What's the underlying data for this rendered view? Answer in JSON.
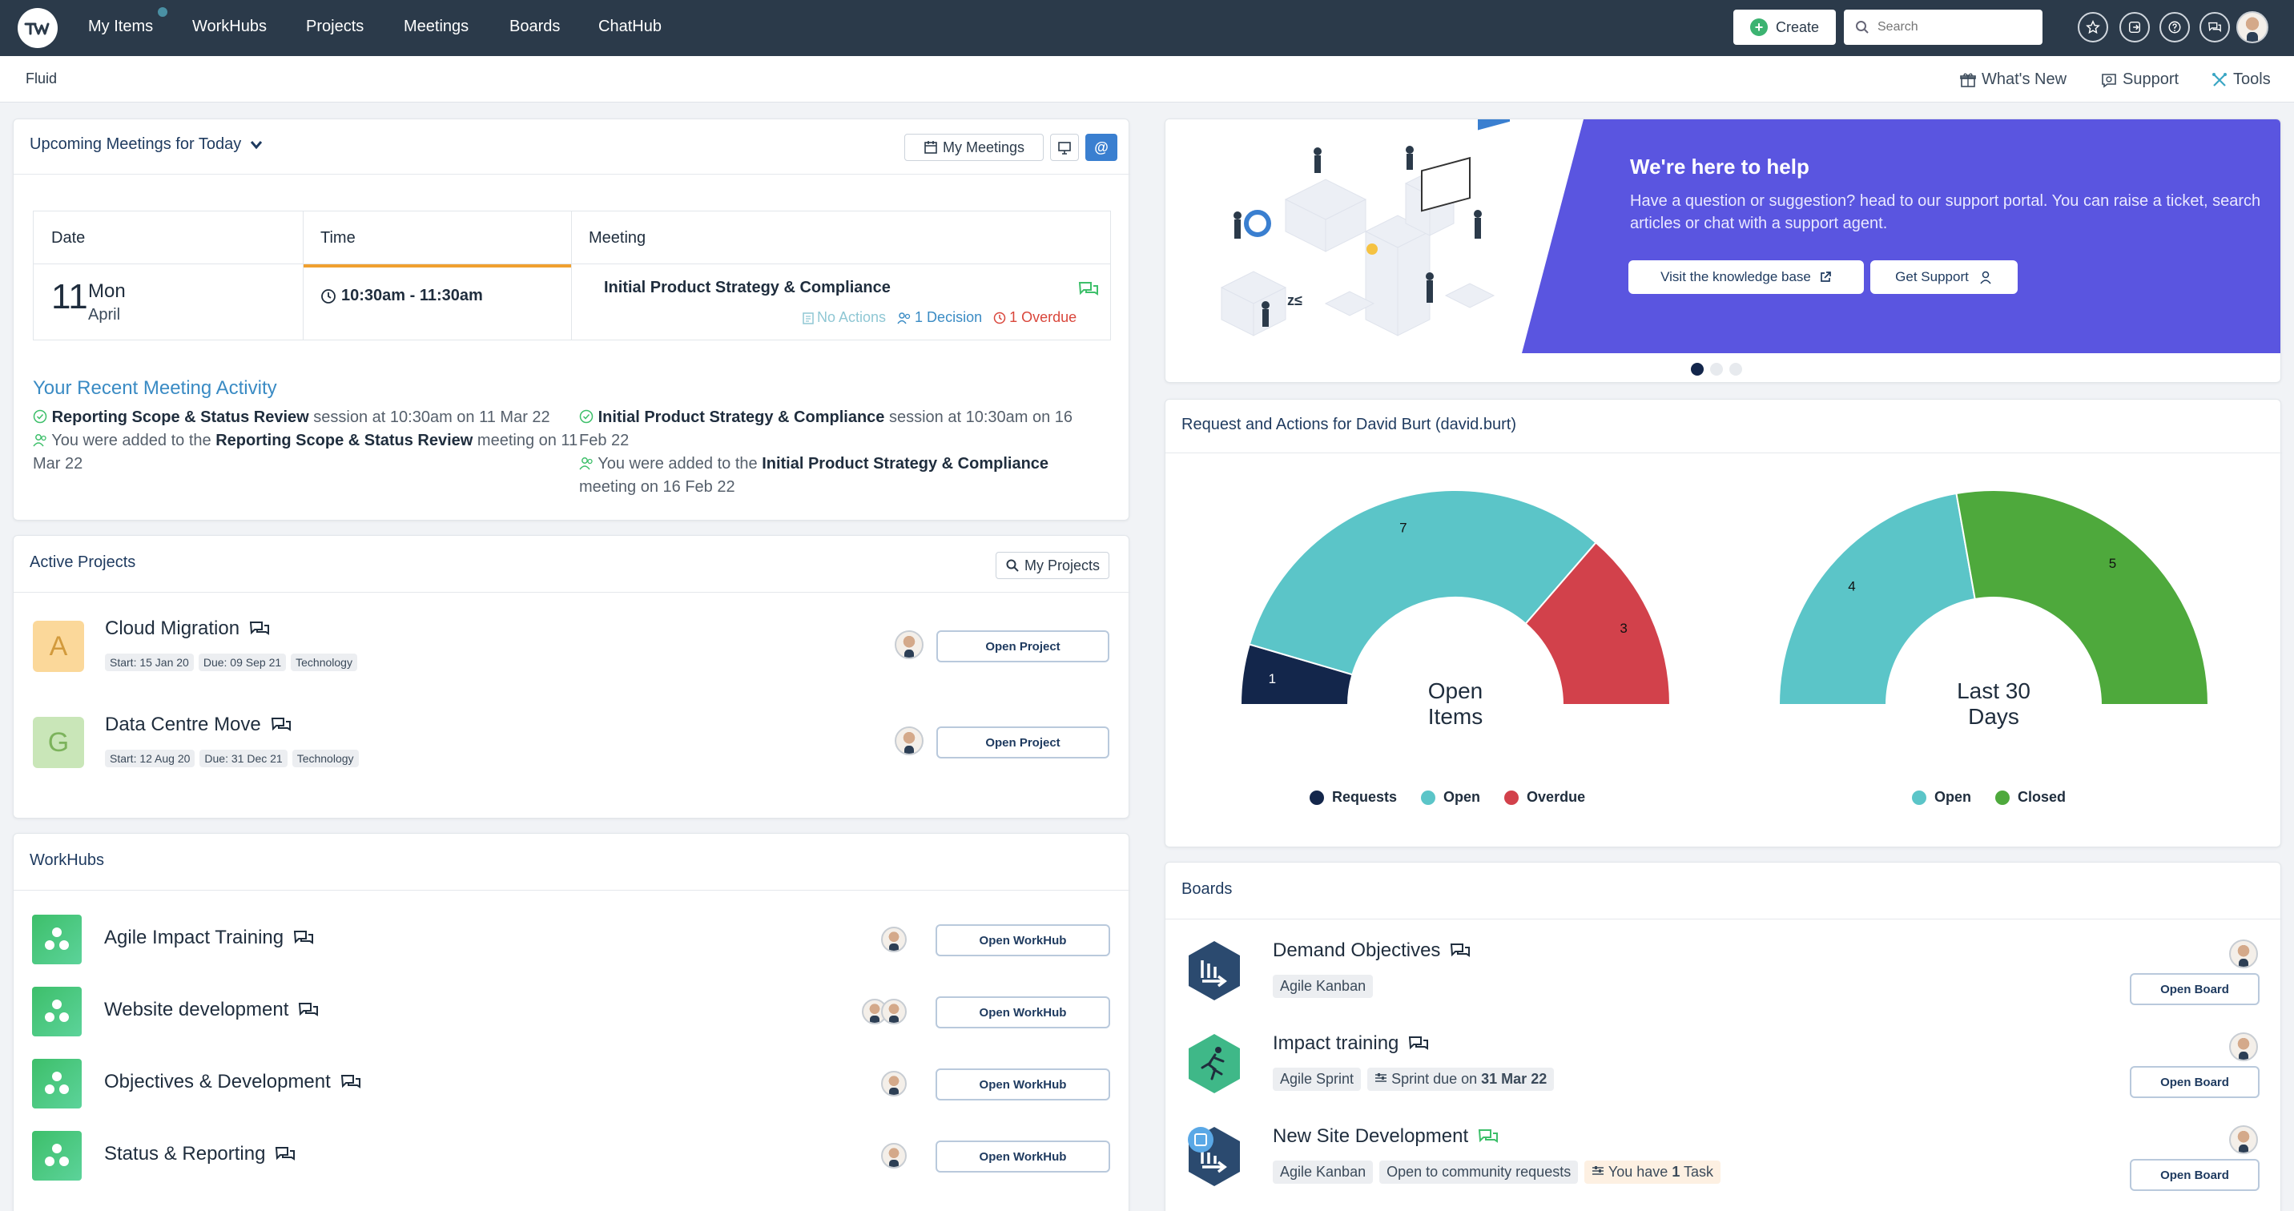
{
  "nav": {
    "items": [
      "My Items",
      "WorkHubs",
      "Projects",
      "Meetings",
      "Boards",
      "ChatHub"
    ],
    "create_label": "Create",
    "search_placeholder": "Search"
  },
  "subbar": {
    "title": "Fluid",
    "whats_new": "What's New",
    "support": "Support",
    "tools": "Tools"
  },
  "meetings": {
    "title": "Upcoming Meetings for Today",
    "my_meetings_label": "My Meetings",
    "headers": [
      "Date",
      "Time",
      "Meeting"
    ],
    "row": {
      "day": "11",
      "weekday": "Mon",
      "month": "April",
      "time": "10:30am - 11:30am",
      "name": "Initial Product Strategy & Compliance",
      "actions": "No Actions",
      "decisions": "1 Decision",
      "overdue": "1 Overdue"
    },
    "activity_title": "Your Recent Meeting Activity",
    "activity": [
      {
        "bold": "Reporting Scope & Status Review",
        "text": " session at 10:30am on 11 Mar 22"
      },
      {
        "pre": "You were added to the ",
        "bold": "Reporting Scope & Status Review",
        "text": " meeting on 11 Mar 22"
      },
      {
        "bold": "Initial Product Strategy & Compliance",
        "text": " session at 10:30am on 16 Feb 22"
      },
      {
        "pre": "You were added to the ",
        "bold": "Initial Product Strategy & Compliance",
        "text": " meeting on 16 Feb 22"
      }
    ]
  },
  "projects": {
    "title": "Active Projects",
    "my_projects_label": "My Projects",
    "open_label": "Open Project",
    "items": [
      {
        "letter": "A",
        "name": "Cloud Migration",
        "start": "Start: 15 Jan 20",
        "due": "Due: 09 Sep 21",
        "category": "Technology"
      },
      {
        "letter": "G",
        "name": "Data Centre Move",
        "start": "Start: 12 Aug 20",
        "due": "Due: 31 Dec 21",
        "category": "Technology"
      }
    ]
  },
  "workhubs": {
    "title": "WorkHubs",
    "open_label": "Open WorkHub",
    "items": [
      "Agile Impact Training",
      "Website development",
      "Objectives & Development",
      "Status & Reporting"
    ]
  },
  "help": {
    "title": "We're here to help",
    "text": "Have a question or suggestion? head to our support portal. You can raise a ticket, search articles or chat with a support agent.",
    "kb_label": "Visit the knowledge base",
    "support_label": "Get Support"
  },
  "requests": {
    "title": "Request and Actions for David Burt (david.burt)"
  },
  "chart_data": [
    {
      "type": "pie",
      "center_label": "Open Items",
      "categories": [
        "Requests",
        "Open",
        "Overdue"
      ],
      "values": [
        1,
        7,
        3
      ],
      "colors": [
        "#13264b",
        "#5bc5c8",
        "#d2414b"
      ]
    },
    {
      "type": "pie",
      "center_label": "Last 30 Days",
      "categories": [
        "Open",
        "Closed"
      ],
      "values": [
        4,
        5
      ],
      "colors": [
        "#5bc5c8",
        "#4ea93c"
      ]
    }
  ],
  "boards": {
    "title": "Boards",
    "open_label": "Open Board",
    "items": [
      {
        "name": "Demand Objectives",
        "tags": [
          "Agile Kanban"
        ]
      },
      {
        "name": "Impact training",
        "tags": [
          "Agile Sprint"
        ],
        "sprint_prefix": "Sprint due on ",
        "sprint_date": "31 Mar 22"
      },
      {
        "name": "New Site Development",
        "tags": [
          "Agile Kanban",
          "Open to community requests"
        ],
        "task_prefix": "You have ",
        "task_count": "1",
        "task_suffix": " Task"
      }
    ]
  },
  "colors": {
    "topbar": "#2b3a4a",
    "banner": "#5a55e0",
    "accent_link": "#3a8bc4",
    "orange": "#f0a030",
    "overdue": "#d9463b"
  }
}
